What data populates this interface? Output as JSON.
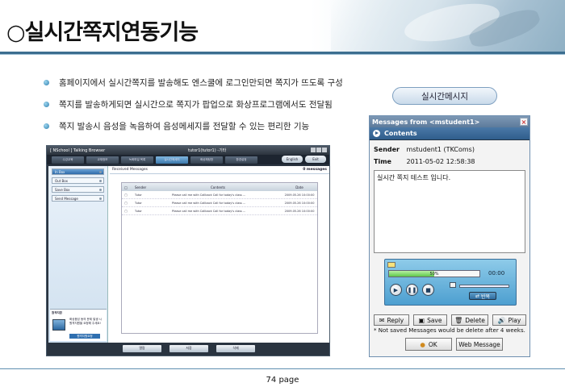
{
  "header": {
    "title": "○실시간쪽지연동기능"
  },
  "bullets": [
    "홈페이지에서 실시간쪽지를 발송해도 엔스쿨에 로그인만되면 쪽지가 뜨도록 구성",
    "쪽지를 발송하게되면 실시간으로 쪽지가 팝업으로 화상프로그램에서도 전달됨",
    "쪽지 발송시 음성을 녹음하여 음성메세지를 전달할 수 있는 편리한 기능"
  ],
  "realtime_label": "실시간메시지",
  "app": {
    "brand": "[ NSchool ]  Talking Browser",
    "window_title": "tutor1(tutor1) -기타",
    "menu": [
      "수강교육",
      "교재정보",
      "녹화파일 목록",
      "실시간메세지",
      "화상채팅방",
      "환경설정"
    ],
    "lang_button": "English",
    "exit_button": "Exit",
    "sidebar": [
      "In Box",
      "Out Box",
      "Save Box",
      "Send Message"
    ],
    "promo_title": "원격지원",
    "promo_text": "화상음성 동의 문제 발생 시 원격지원을 요청해 주세요!",
    "promo_button": "원격지원요청",
    "received_label": "Received Messages",
    "count_label": "0 messages",
    "table_headers": [
      "Sender",
      "Contents",
      "Date"
    ],
    "rows": [
      {
        "sender": "Tutor",
        "contents": "Please call me with Callback Call for today's class ...",
        "date": "2009.05.26  10:00:00"
      },
      {
        "sender": "Tutor",
        "contents": "Please call me with Callback Call for today's class ...",
        "date": "2009.05.26  10:00:00"
      },
      {
        "sender": "Tutor",
        "contents": "Please call me with Callback Call for today's class ...",
        "date": "2009.05.26  10:00:00"
      }
    ],
    "footer_buttons": [
      "열람",
      "저장",
      "삭제"
    ]
  },
  "message_window": {
    "title": "Messages from <mstudent1>",
    "contents_label": "Contents",
    "sender_label": "Sender",
    "sender_value": "mstudent1 (TKComs)",
    "time_label": "Time",
    "time_value": "2011-05-02 12:58:38",
    "body": "실시간 쪽지 테스트 입니다.",
    "progress_percent": 50,
    "progress_text": "50%",
    "time_display": "00:00",
    "loop_label": "반복",
    "buttons": [
      "Reply",
      "Save",
      "Delete",
      "Play"
    ],
    "note": "* Not saved Messages would be delete after 4 weeks.",
    "ok_button": "OK",
    "web_button": "Web Message"
  },
  "footer": {
    "page": "74 page"
  }
}
